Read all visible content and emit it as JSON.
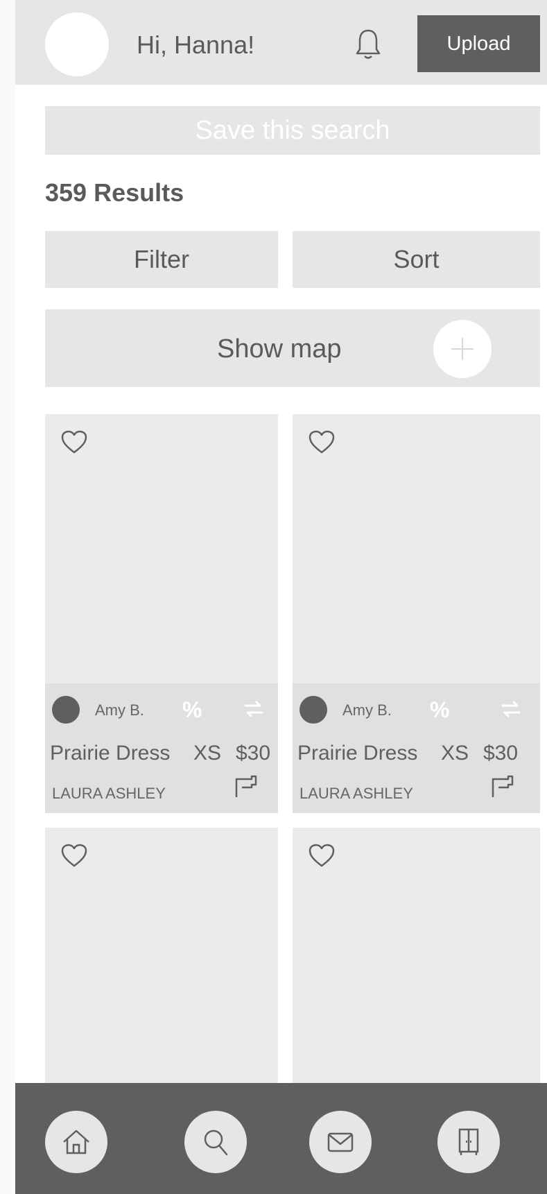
{
  "header": {
    "greeting": "Hi, Hanna!",
    "upload_label": "Upload"
  },
  "search": {
    "save_label": "Save this search",
    "results_label": "359 Results"
  },
  "controls": {
    "filter_label": "Filter",
    "sort_label": "Sort",
    "map_label": "Show map"
  },
  "listings": [
    {
      "seller": "Amy B.",
      "title": "Prairie Dress",
      "size": "XS",
      "price": "$30",
      "brand": "LAURA ASHLEY"
    },
    {
      "seller": "Amy B.",
      "title": "Prairie Dress",
      "size": "XS",
      "price": "$30",
      "brand": "LAURA ASHLEY"
    }
  ],
  "nav": {
    "items": [
      "home-icon",
      "search-icon",
      "mail-icon",
      "wardrobe-icon"
    ]
  },
  "colors": {
    "header_bg": "#e6e6e6",
    "dark": "#5f5f5f",
    "card_bg": "#eaeaea"
  }
}
